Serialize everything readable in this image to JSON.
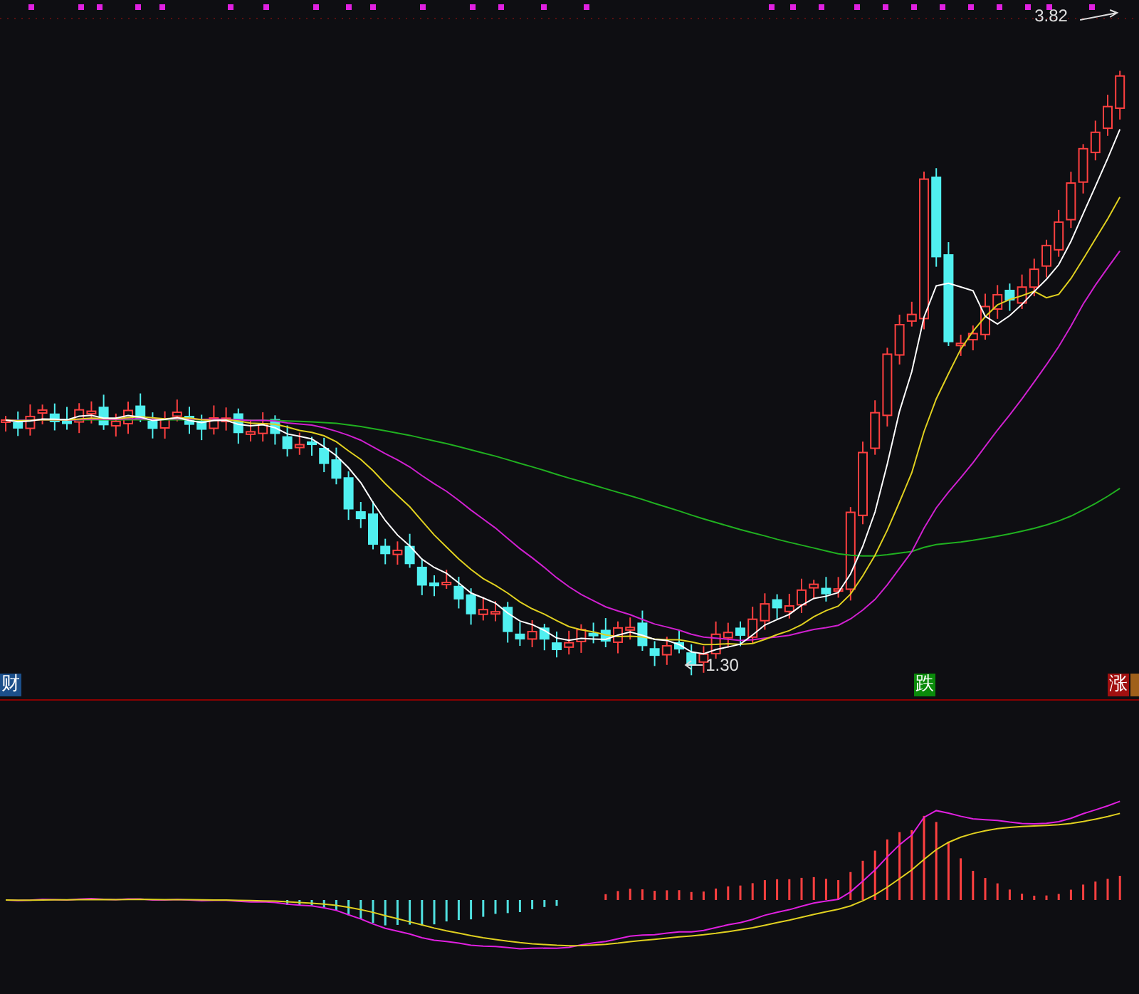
{
  "price_chart": {
    "high_label": "3.82",
    "low_label": "1.30",
    "tags": [
      {
        "text": "财",
        "color": "#1c4f8a"
      },
      {
        "text": "跌",
        "color": "#0a8a0a"
      },
      {
        "text": "涨",
        "color": "#a01010"
      }
    ]
  }
}
